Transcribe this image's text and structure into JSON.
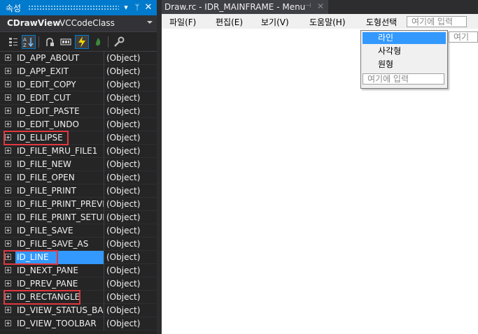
{
  "properties_panel": {
    "title": "속성",
    "class_name": "CDrawView",
    "class_type": "VCCodeClass",
    "rows": [
      {
        "name": "ID_APP_ABOUT",
        "value": "(Object)"
      },
      {
        "name": "ID_APP_EXIT",
        "value": "(Object)"
      },
      {
        "name": "ID_EDIT_COPY",
        "value": "(Object)"
      },
      {
        "name": "ID_EDIT_CUT",
        "value": "(Object)"
      },
      {
        "name": "ID_EDIT_PASTE",
        "value": "(Object)"
      },
      {
        "name": "ID_EDIT_UNDO",
        "value": "(Object)"
      },
      {
        "name": "ID_ELLIPSE",
        "value": "(Object)"
      },
      {
        "name": "ID_FILE_MRU_FILE1",
        "value": "(Object)"
      },
      {
        "name": "ID_FILE_NEW",
        "value": "(Object)"
      },
      {
        "name": "ID_FILE_OPEN",
        "value": "(Object)"
      },
      {
        "name": "ID_FILE_PRINT",
        "value": "(Object)"
      },
      {
        "name": "ID_FILE_PRINT_PREVIEW",
        "value": "(Object)"
      },
      {
        "name": "ID_FILE_PRINT_SETUP",
        "value": "(Object)"
      },
      {
        "name": "ID_FILE_SAVE",
        "value": "(Object)"
      },
      {
        "name": "ID_FILE_SAVE_AS",
        "value": "(Object)"
      },
      {
        "name": "ID_LINE",
        "value": "(Object)"
      },
      {
        "name": "ID_NEXT_PANE",
        "value": "(Object)"
      },
      {
        "name": "ID_PREV_PANE",
        "value": "(Object)"
      },
      {
        "name": "ID_RECTANGLE",
        "value": "(Object)"
      },
      {
        "name": "ID_VIEW_STATUS_BAR",
        "value": "(Object)"
      },
      {
        "name": "ID_VIEW_TOOLBAR",
        "value": "(Object)"
      }
    ],
    "selected_row": "ID_LINE",
    "highlighted_rows": [
      "ID_ELLIPSE",
      "ID_LINE",
      "ID_RECTANGLE"
    ]
  },
  "editor": {
    "tab_title": "Draw.rc - IDR_MAINFRAME - Menu",
    "menu": {
      "items": [
        "파일(F)",
        "편집(E)",
        "보기(V)",
        "도움말(H)",
        "도형선택"
      ],
      "type_here": "여기에 입력",
      "side_type_here": "여기",
      "dropdown": {
        "items": [
          "라인",
          "사각형",
          "원형"
        ],
        "selected": "라인",
        "type_here": "여기에 입력"
      }
    }
  },
  "colors": {
    "accent": "#007acc",
    "selection": "#3399ff",
    "highlight_box": "#e0383e",
    "panel_bg": "#252526"
  },
  "icons": [
    "categorized-icon",
    "alphabetical-icon",
    "properties-icon",
    "messages-icon",
    "events-icon",
    "overrides-icon",
    "property-pages-icon"
  ]
}
